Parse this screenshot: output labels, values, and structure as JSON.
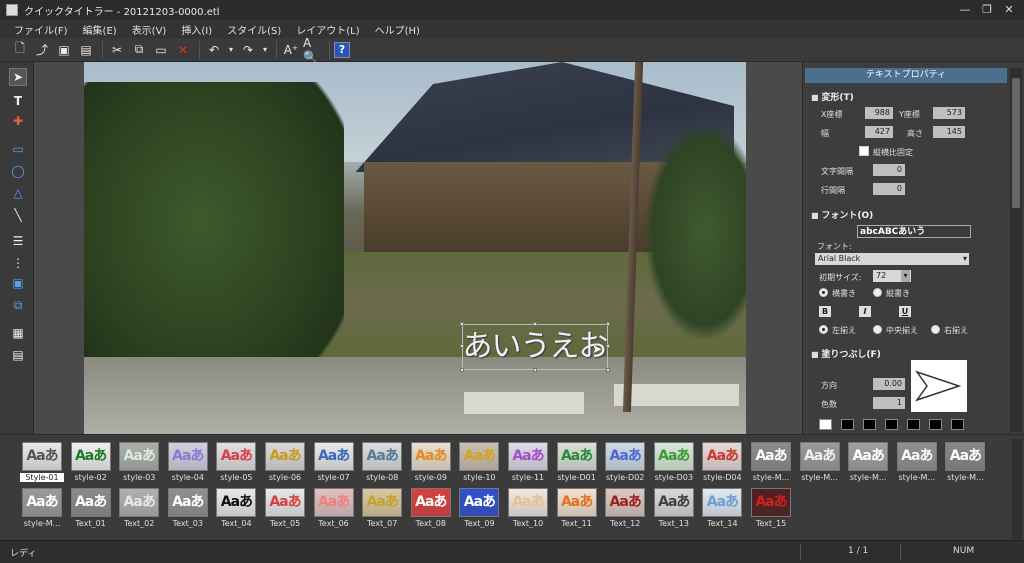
{
  "window": {
    "title": "クイックタイトラー - 20121203-0000.etl"
  },
  "menu": [
    "ファイル(F)",
    "編集(E)",
    "表示(V)",
    "挿入(I)",
    "スタイル(S)",
    "レイアウト(L)",
    "ヘルプ(H)"
  ],
  "toolbar": {
    "help_label": "?"
  },
  "canvas": {
    "text_object": "あいうえお"
  },
  "panel": {
    "title": "テキストプロパティ",
    "transform": {
      "title": "変形(T)",
      "x_label": "X座標",
      "x_value": "988",
      "y_label": "Y座標",
      "y_value": "573",
      "w_label": "幅",
      "w_value": "427",
      "h_label": "高さ",
      "h_value": "145",
      "keep_ratio": "縦横比固定",
      "char_spacing_label": "文字間隔",
      "char_spacing_value": "0",
      "line_spacing_label": "行間隔",
      "line_spacing_value": "0"
    },
    "font": {
      "title": "フォント(O)",
      "preview": "abcABCあいう",
      "font_label": "フォント:",
      "font_value": "Arial Black",
      "size_label": "初期サイズ:",
      "size_value": "72",
      "horizontal": "横書き",
      "vertical": "縦書き",
      "bold": "B",
      "italic": "I",
      "underline": "U",
      "align_left": "左揃え",
      "align_center": "中央揃え",
      "align_right": "右揃え"
    },
    "fill": {
      "title": "塗りつぶし(F)",
      "direction_label": "方向",
      "direction_value": "0.00",
      "colors_label": "色数",
      "colors_value": "1"
    }
  },
  "gallery": {
    "row1": [
      {
        "label": "Style-01",
        "sample": "Aaあ",
        "color": "#555555",
        "bg": "#e8e8e8",
        "selected": true
      },
      {
        "label": "style-02",
        "sample": "Aaあ",
        "color": "#1f7a2a",
        "bg": "#f0f0f0"
      },
      {
        "label": "style-03",
        "sample": "Aaあ",
        "color": "#dfe8e0",
        "bg": "#a8b0a8"
      },
      {
        "label": "style-04",
        "sample": "Aaあ",
        "color": "#8a7ad8",
        "bg": "#d0d0e0"
      },
      {
        "label": "style-05",
        "sample": "Aaあ",
        "color": "#d8404a",
        "bg": "#e0e0e0"
      },
      {
        "label": "style-06",
        "sample": "Aaあ",
        "color": "#c89a20",
        "bg": "#d8d8d8"
      },
      {
        "label": "style-07",
        "sample": "Aaあ",
        "color": "#3a6ab8",
        "bg": "#e8e8e8"
      },
      {
        "label": "style-08",
        "sample": "Aaあ",
        "color": "#5a7890",
        "bg": "#d8dde0"
      },
      {
        "label": "style-09",
        "sample": "Aaあ",
        "color": "#e88a20",
        "bg": "#e8e0d0"
      },
      {
        "label": "style-10",
        "sample": "Aaあ",
        "color": "#d8a020",
        "bg": "#c8c0b0"
      },
      {
        "label": "style-11",
        "sample": "Aaあ",
        "color": "#a050c8",
        "bg": "#e0d8e8"
      },
      {
        "label": "style-D01",
        "sample": "Aaあ",
        "color": "#2a8a3a",
        "bg": "#d8e0d8"
      },
      {
        "label": "style-D02",
        "sample": "Aaあ",
        "color": "#4a6ad0",
        "bg": "#d0d8e8"
      },
      {
        "label": "style-D03",
        "sample": "Aaあ",
        "color": "#3a9a3a",
        "bg": "#d8e8d8"
      },
      {
        "label": "style-D04",
        "sample": "Aaあ",
        "color": "#c83a30",
        "bg": "#e8d8d8"
      },
      {
        "label": "style-M...",
        "sample": "Aaあ",
        "color": "#ffffff",
        "bg": "#8c8c8c"
      },
      {
        "label": "style-M...",
        "sample": "Aaあ",
        "color": "#f0f0f0",
        "bg": "#9a9a9a"
      },
      {
        "label": "style-M...",
        "sample": "Aaあ",
        "color": "#ffffff",
        "bg": "#a0a0a0"
      },
      {
        "label": "style-M...",
        "sample": "Aaあ",
        "color": "#f8f8f8",
        "bg": "#909090"
      },
      {
        "label": "style-M...",
        "sample": "Aaあ",
        "color": "#ffffff",
        "bg": "#888888"
      }
    ],
    "row2": [
      {
        "label": "style-M...",
        "sample": "Aaあ",
        "color": "#ffffff",
        "bg": "#9a9a9a"
      },
      {
        "label": "Text_01",
        "sample": "Aaあ",
        "color": "#ffffff",
        "bg": "#8a8a8a"
      },
      {
        "label": "Text_02",
        "sample": "Aaあ",
        "color": "#e8e8e8",
        "bg": "#b0b0b0"
      },
      {
        "label": "Text_03",
        "sample": "Aaあ",
        "color": "#ffffff",
        "bg": "#909090"
      },
      {
        "label": "Text_04",
        "sample": "Aaあ",
        "color": "#111111",
        "bg": "#e8e8e8"
      },
      {
        "label": "Text_05",
        "sample": "Aaあ",
        "color": "#d84040",
        "bg": "#e8e8e8"
      },
      {
        "label": "Text_06",
        "sample": "Aaあ",
        "color": "#f08080",
        "bg": "#e0c0c0"
      },
      {
        "label": "Text_07",
        "sample": "Aaあ",
        "color": "#c8a030",
        "bg": "#d8c8a0"
      },
      {
        "label": "Text_08",
        "sample": "Aaあ",
        "color": "#ffffff",
        "bg": "#d84040"
      },
      {
        "label": "Text_09",
        "sample": "Aaあ",
        "color": "#ffffff",
        "bg": "#3050d0"
      },
      {
        "label": "Text_10",
        "sample": "Aaあ",
        "color": "#e8c090",
        "bg": "#f0e8e0"
      },
      {
        "label": "Text_11",
        "sample": "Aaあ",
        "color": "#e87020",
        "bg": "#f0e0d0"
      },
      {
        "label": "Text_12",
        "sample": "Aaあ",
        "color": "#a02020",
        "bg": "#d8c8c0"
      },
      {
        "label": "Text_13",
        "sample": "Aaあ",
        "color": "#404040",
        "bg": "#d8d8d8"
      },
      {
        "label": "Text_14",
        "sample": "Aaあ",
        "color": "#70a0d0",
        "bg": "#e0e8f0"
      },
      {
        "label": "Text_15",
        "sample": "Aaあ",
        "color": "#d02020",
        "bg": "#502020"
      }
    ]
  },
  "status": {
    "left": "レディ",
    "page": "1 / 1",
    "num": "NUM"
  }
}
